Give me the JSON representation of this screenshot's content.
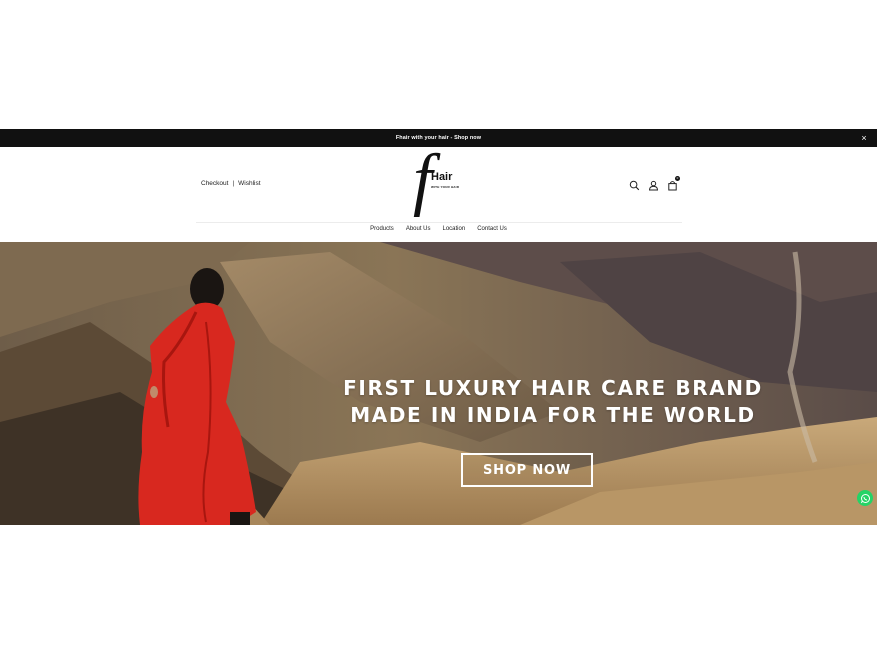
{
  "announcement": {
    "text": "Fhair with your hair - Shop now",
    "close": "×"
  },
  "header": {
    "links": {
      "checkout": "Checkout",
      "wishlist": "Wishlist",
      "separator": "|"
    },
    "logo": {
      "letter": "f",
      "word": "Hair",
      "tagline": "WITH YOUR HAIR"
    },
    "icons": {
      "search": "search-icon",
      "account": "user-icon",
      "cart": "bag-icon"
    },
    "cart_count": "0"
  },
  "nav": {
    "items": [
      "Products",
      "About Us",
      "Location",
      "Contact Us"
    ]
  },
  "hero": {
    "headline_line1": "FIRST LUXURY HAIR CARE BRAND",
    "headline_line2": "MADE IN INDIA FOR THE WORLD",
    "cta": "SHOP NOW"
  },
  "colors": {
    "topbar": "#111111",
    "dress": "#d8281f",
    "whatsapp": "#25d366"
  }
}
